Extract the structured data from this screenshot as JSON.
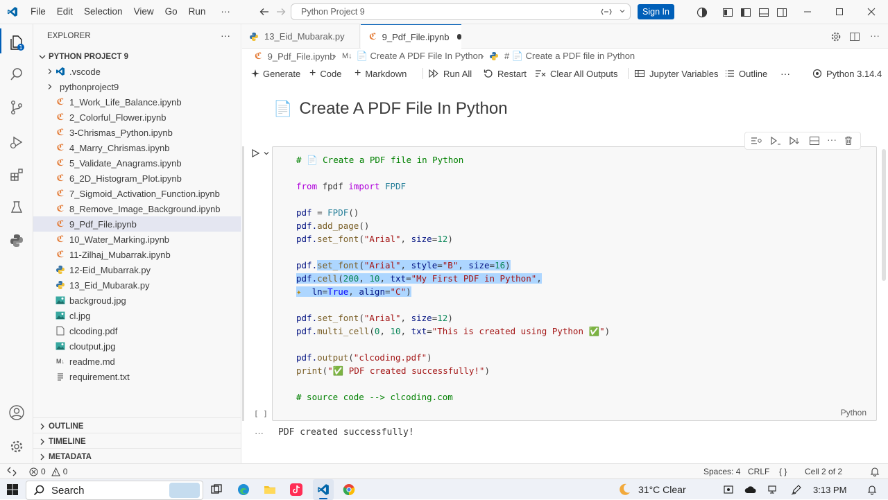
{
  "titlebar": {
    "menu": [
      "File",
      "Edit",
      "Selection",
      "View",
      "Go",
      "Run"
    ],
    "more": "···",
    "search": "Python Project 9",
    "signin": "Sign In"
  },
  "sidebar": {
    "header": "EXPLORER",
    "project": "PYTHON PROJECT 9",
    "items": [
      {
        "label": ".vscode",
        "kind": "folder-vscode"
      },
      {
        "label": "pythonproject9",
        "kind": "folder"
      },
      {
        "label": "1_Work_Life_Balance.ipynb",
        "kind": "notebook"
      },
      {
        "label": "2_Colorful_Flower.ipynb",
        "kind": "notebook"
      },
      {
        "label": "3-Chrismas_Python.ipynb",
        "kind": "notebook"
      },
      {
        "label": "4_Marry_Chrismas.ipynb",
        "kind": "notebook"
      },
      {
        "label": "5_Validate_Anagrams.ipynb",
        "kind": "notebook"
      },
      {
        "label": "6_2D_Histogram_Plot.ipynb",
        "kind": "notebook"
      },
      {
        "label": "7_Sigmoid_Activation_Function.ipynb",
        "kind": "notebook"
      },
      {
        "label": "8_Remove_Image_Background.ipynb",
        "kind": "notebook"
      },
      {
        "label": "9_Pdf_File.ipynb",
        "kind": "notebook"
      },
      {
        "label": "10_Water_Marking.ipynb",
        "kind": "notebook"
      },
      {
        "label": "11-Zilhaj_Mubarrak.ipynb",
        "kind": "notebook"
      },
      {
        "label": "12-Eid_Mubarrak.py",
        "kind": "python"
      },
      {
        "label": "13_Eid_Mubarak.py",
        "kind": "python"
      },
      {
        "label": "backgroud.jpg",
        "kind": "image"
      },
      {
        "label": "cl.jpg",
        "kind": "image"
      },
      {
        "label": "clcoding.pdf",
        "kind": "pdf"
      },
      {
        "label": "cloutput.jpg",
        "kind": "image"
      },
      {
        "label": "readme.md",
        "kind": "markdown"
      },
      {
        "label": "requirement.txt",
        "kind": "text"
      }
    ],
    "sections": [
      "OUTLINE",
      "TIMELINE",
      "METADATA"
    ]
  },
  "tabs": [
    {
      "label": "13_Eid_Mubarak.py",
      "active": false
    },
    {
      "label": "9_Pdf_File.ipynb",
      "active": true
    }
  ],
  "breadcrumbs": [
    "9_Pdf_File.ipynb",
    "M↓",
    "📄 Create A PDF File In Python",
    "# 📄 Create a PDF file in Python"
  ],
  "toolbar": {
    "generate": "Generate",
    "code": "Code",
    "markdown": "Markdown",
    "run_all": "Run All",
    "restart": "Restart",
    "clear": "Clear All Outputs",
    "variables": "Jupyter Variables",
    "outline": "Outline",
    "more": "···",
    "kernel": "Python 3.14.4"
  },
  "notebook": {
    "heading": "Create A PDF File In Python",
    "heading_icon": "📄",
    "exec_count": "[ ]",
    "language": "Python",
    "output": "PDF created successfully!",
    "output_more": "···"
  },
  "code": {
    "l1": "# 📄 Create a PDF file in Python",
    "l2a": "from",
    "l2b": " fpdf ",
    "l2c": "import",
    "l2d": " FPDF",
    "l3a": "pdf",
    "l3b": " = ",
    "l3c": "FPDF",
    "l3d": "()",
    "l4a": "pdf.",
    "l4b": "add_page",
    "l4c": "()",
    "l5a": "pdf.",
    "l5b": "set_font",
    "l5c": "(",
    "l5d": "\"Arial\"",
    "l5e": ", ",
    "l5f": "size",
    "l5g": "=",
    "l5h": "12",
    "l5i": ")",
    "l6a": "pdf.",
    "l6b": "set_font",
    "l6c": "(",
    "l6d": "\"Arial\"",
    "l6e": ", ",
    "l6f": "style",
    "l6g": "=",
    "l6h": "\"B\"",
    "l6i": ", ",
    "l6j": "size",
    "l6k": "=",
    "l6l": "16",
    "l6m": ")",
    "l7a": "pdf.",
    "l7b": "cell",
    "l7c": "(",
    "l7d": "200",
    "l7e": ", ",
    "l7f": "10",
    "l7g": ", ",
    "l7h": "txt",
    "l7i": "=",
    "l7j": "\"My First PDF in Python\"",
    "l7k": ",",
    "l8a": "ln",
    "l8b": "=",
    "l8c": "True",
    "l8d": ", ",
    "l8e": "align",
    "l8f": "=",
    "l8g": "\"C\"",
    "l8h": ")",
    "l9a": "pdf.",
    "l9b": "set_font",
    "l9c": "(",
    "l9d": "\"Arial\"",
    "l9e": ", ",
    "l9f": "size",
    "l9g": "=",
    "l9h": "12",
    "l9i": ")",
    "l10a": "pdf.",
    "l10b": "multi_cell",
    "l10c": "(",
    "l10d": "0",
    "l10e": ", ",
    "l10f": "10",
    "l10g": ", ",
    "l10h": "txt",
    "l10i": "=",
    "l10j": "\"This is created using Python ✅\"",
    "l10k": ")",
    "l11a": "pdf.",
    "l11b": "output",
    "l11c": "(",
    "l11d": "\"clcoding.pdf\"",
    "l11e": ")",
    "l12a": "print",
    "l12b": "(",
    "l12c": "\"✅ PDF created successfully!\"",
    "l12d": ")",
    "l13": "# source code --> clcoding.com"
  },
  "statusbar": {
    "errors": "0",
    "warnings": "0",
    "spaces": "Spaces: 4",
    "eol": "CRLF",
    "braces": "{ }",
    "cell": "Cell 2 of 2"
  },
  "taskbar": {
    "search": "Search",
    "weather": "31°C  Clear",
    "time": "3:13 PM"
  }
}
